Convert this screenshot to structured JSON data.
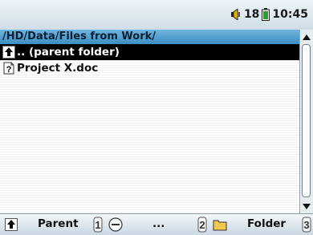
{
  "status": {
    "volume": "18",
    "time": "10:45"
  },
  "path": "/HD/Data/Files from Work/",
  "files": [
    {
      "name": ".. (parent folder)",
      "selected": true,
      "icon": "parent-folder-icon"
    },
    {
      "name": "Project X.doc",
      "selected": false,
      "icon": "unknown-file-icon"
    }
  ],
  "functions": [
    {
      "label": "Parent",
      "icon": "parent-folder-icon"
    },
    {
      "label": "...",
      "icon": "menu-dots-icon"
    },
    {
      "label": "Folder",
      "icon": "folder-icon"
    }
  ]
}
